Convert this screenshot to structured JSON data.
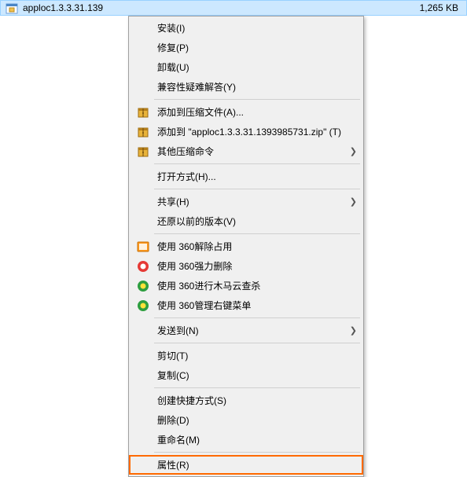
{
  "file_row": {
    "name": "apploc1.3.3.31.139",
    "size": "1,265 KB"
  },
  "menu": {
    "groups": [
      [
        {
          "id": "install",
          "label": "安装(I)",
          "icon": "",
          "submenu": false
        },
        {
          "id": "repair",
          "label": "修复(P)",
          "icon": "",
          "submenu": false
        },
        {
          "id": "uninstall",
          "label": "卸载(U)",
          "icon": "",
          "submenu": false
        },
        {
          "id": "compat",
          "label": "兼容性疑难解答(Y)",
          "icon": "",
          "submenu": false
        }
      ],
      [
        {
          "id": "add-archive",
          "label": "添加到压缩文件(A)...",
          "icon": "archive",
          "submenu": false
        },
        {
          "id": "add-zip",
          "label": "添加到 \"apploc1.3.3.31.1393985731.zip\" (T)",
          "icon": "archive",
          "submenu": false
        },
        {
          "id": "other-archive",
          "label": "其他压缩命令",
          "icon": "archive",
          "submenu": true
        }
      ],
      [
        {
          "id": "open-with",
          "label": "打开方式(H)...",
          "icon": "",
          "submenu": false
        }
      ],
      [
        {
          "id": "share",
          "label": "共享(H)",
          "icon": "",
          "submenu": true
        },
        {
          "id": "restore-prev",
          "label": "还原以前的版本(V)",
          "icon": "",
          "submenu": false
        }
      ],
      [
        {
          "id": "360-unlock",
          "label": "使用 360解除占用",
          "icon": "360-orange",
          "submenu": false
        },
        {
          "id": "360-force-delete",
          "label": "使用 360强力删除",
          "icon": "360-red",
          "submenu": false
        },
        {
          "id": "360-cloud-scan",
          "label": "使用 360进行木马云查杀",
          "icon": "360-green",
          "submenu": false
        },
        {
          "id": "360-menu-manage",
          "label": "使用 360管理右键菜单",
          "icon": "360-green",
          "submenu": false
        }
      ],
      [
        {
          "id": "send-to",
          "label": "发送到(N)",
          "icon": "",
          "submenu": true
        }
      ],
      [
        {
          "id": "cut",
          "label": "剪切(T)",
          "icon": "",
          "submenu": false
        },
        {
          "id": "copy",
          "label": "复制(C)",
          "icon": "",
          "submenu": false
        }
      ],
      [
        {
          "id": "shortcut",
          "label": "创建快捷方式(S)",
          "icon": "",
          "submenu": false
        },
        {
          "id": "delete",
          "label": "删除(D)",
          "icon": "",
          "submenu": false
        },
        {
          "id": "rename",
          "label": "重命名(M)",
          "icon": "",
          "submenu": false
        }
      ],
      [
        {
          "id": "properties",
          "label": "属性(R)",
          "icon": "",
          "submenu": false,
          "highlight": true
        }
      ]
    ]
  }
}
